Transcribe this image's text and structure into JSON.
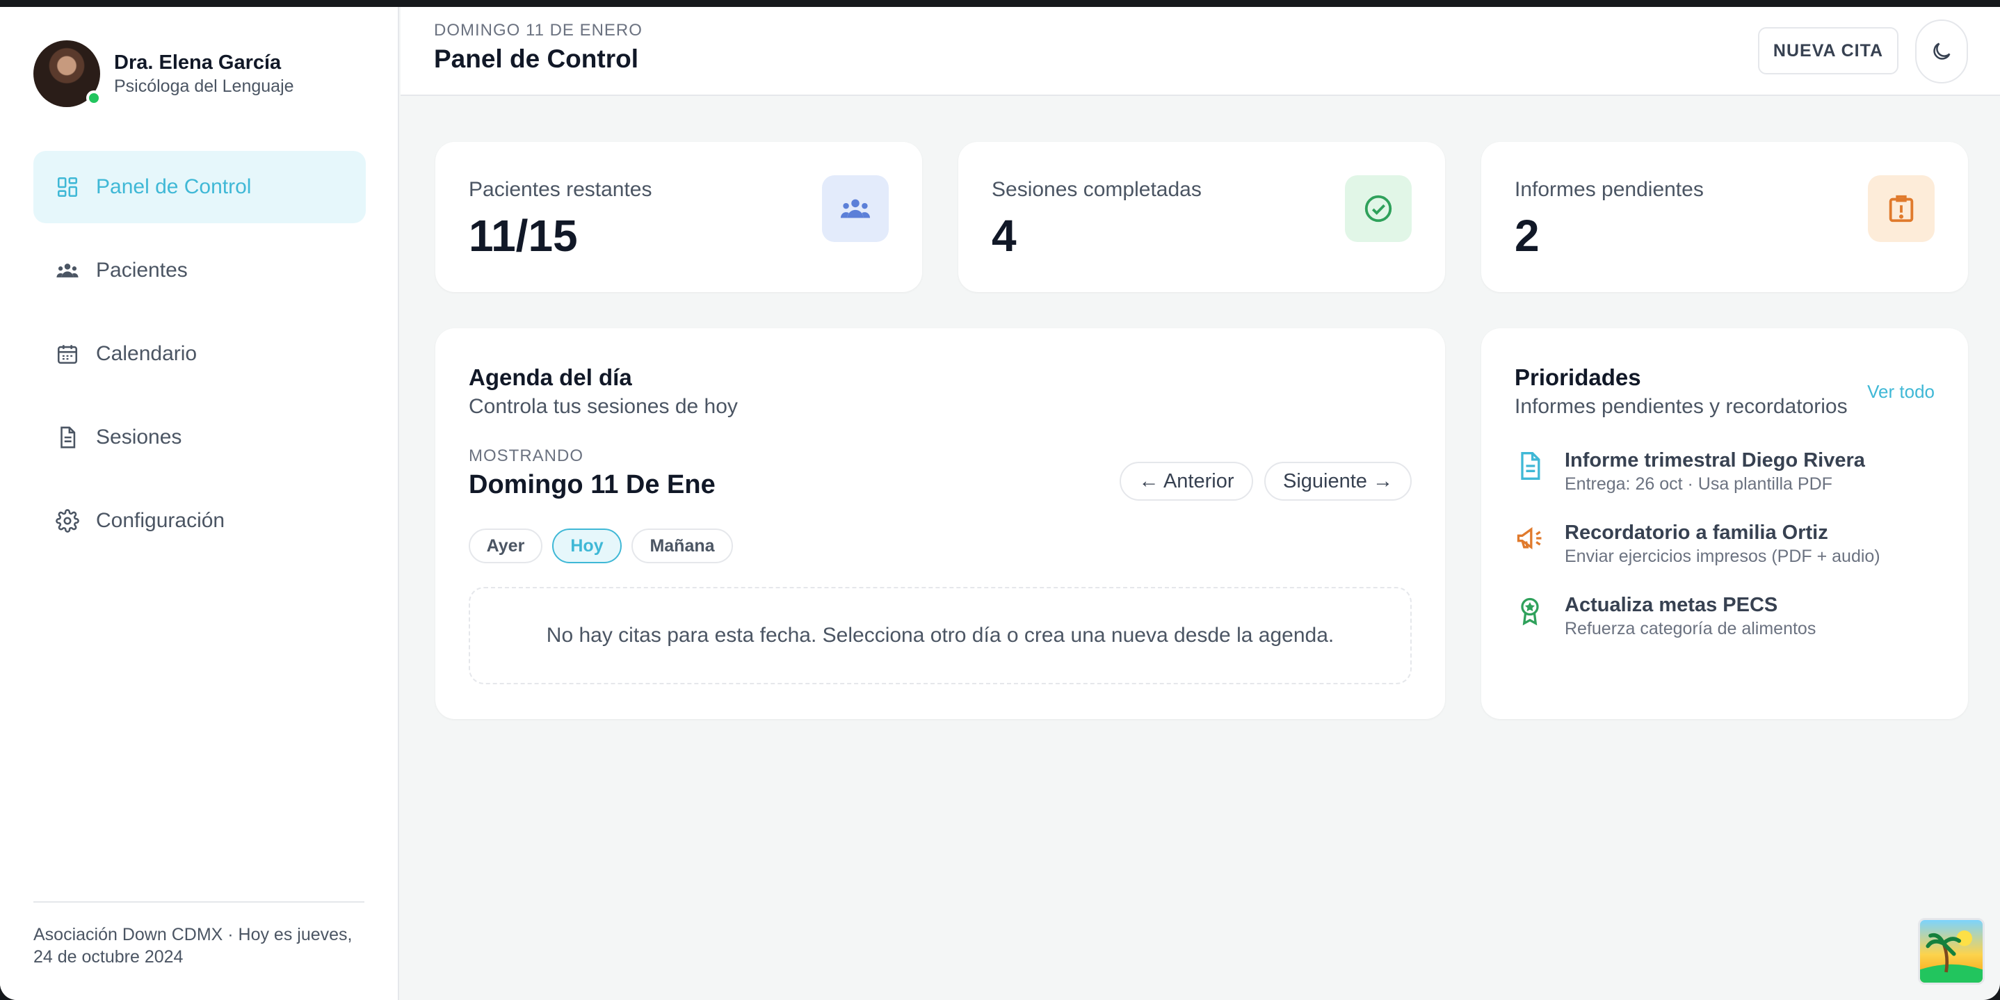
{
  "profile": {
    "name": "Dra. Elena García",
    "role": "Psicóloga del Lenguaje"
  },
  "nav": [
    {
      "label": "Panel de Control",
      "icon": "dashboard-icon",
      "active": true
    },
    {
      "label": "Pacientes",
      "icon": "users-icon",
      "active": false
    },
    {
      "label": "Calendario",
      "icon": "calendar-icon",
      "active": false
    },
    {
      "label": "Sesiones",
      "icon": "document-icon",
      "active": false
    },
    {
      "label": "Configuración",
      "icon": "gear-icon",
      "active": false
    }
  ],
  "footer": {
    "text": "Asociación Down CDMX · Hoy es jueves, 24 de octubre 2024"
  },
  "header": {
    "date": "DOMINGO 11 DE ENERO",
    "title": "Panel de Control",
    "new_button": "NUEVA CITA",
    "theme_icon": "moon-icon"
  },
  "stats": [
    {
      "label": "Pacientes restantes",
      "value": "11/15",
      "icon": "users-icon",
      "color": "#5b7fd8"
    },
    {
      "label": "Sesiones completadas",
      "value": "4",
      "icon": "check-circle-icon",
      "color": "#2fa15b"
    },
    {
      "label": "Informes pendientes",
      "value": "2",
      "icon": "alert-icon",
      "color": "#e07a2c"
    }
  ],
  "agenda": {
    "title": "Agenda del día",
    "subtitle": "Controla tus sesiones de hoy",
    "showing_label": "MOSTRANDO",
    "current_date": "Domingo 11 De Ene",
    "prev": "← Anterior",
    "next": "Siguiente →",
    "chips": [
      "Ayer",
      "Hoy",
      "Mañana"
    ],
    "active_chip": "Hoy",
    "empty": "No hay citas para esta fecha. Selecciona otro día o crea una nueva desde la agenda."
  },
  "priorities": {
    "title": "Prioridades",
    "subtitle": "Informes pendientes y recordatorios",
    "see_all": "Ver todo",
    "items": [
      {
        "title": "Informe trimestral Diego Rivera",
        "detail": "Entrega: 26 oct · Usa plantilla PDF",
        "icon": "document-icon",
        "color": "#3fb8d6"
      },
      {
        "title": "Recordatorio a familia Ortiz",
        "detail": "Enviar ejercicios impresos (PDF + audio)",
        "icon": "megaphone-icon",
        "color": "#e07a2c"
      },
      {
        "title": "Actualiza metas PECS",
        "detail": "Refuerza categoría de alimentos",
        "icon": "award-icon",
        "color": "#2fa15b"
      }
    ]
  },
  "colors": {
    "accent": "#3fb8d6",
    "background": "#f4f6f6"
  }
}
